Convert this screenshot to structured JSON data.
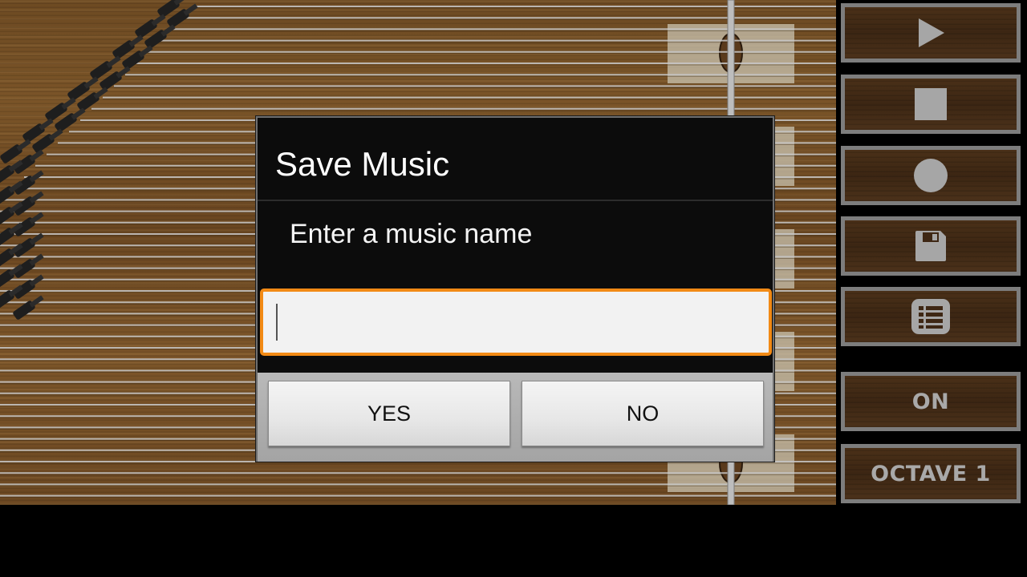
{
  "dialog": {
    "title": "Save Music",
    "message": "Enter a music name",
    "input_value": "",
    "yes_label": "YES",
    "no_label": "NO"
  },
  "controls": {
    "play_icon": "play-icon",
    "stop_icon": "stop-icon",
    "record_icon": "record-icon",
    "save_icon": "save-icon",
    "list_icon": "list-icon",
    "toggle_label": "ON",
    "octave_label": "OCTAVE 1"
  },
  "colors": {
    "accent": "#f28a15",
    "wood": "#6d4a22",
    "control_text": "#a9a9a9"
  }
}
